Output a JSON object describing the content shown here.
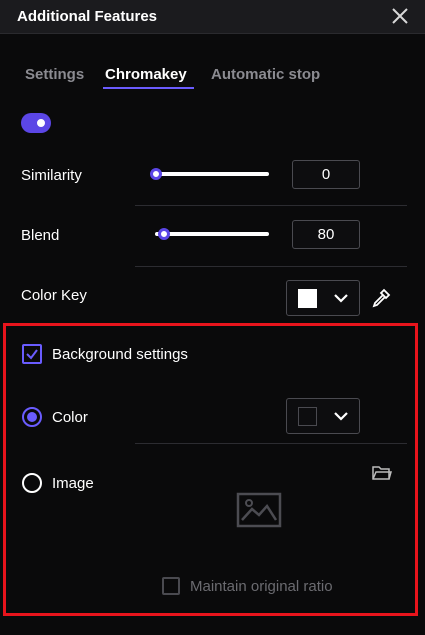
{
  "window": {
    "title": "Additional Features"
  },
  "tabs": [
    {
      "label": "Settings",
      "active": false
    },
    {
      "label": "Chromakey",
      "active": true
    },
    {
      "label": "Automatic stop",
      "active": false
    }
  ],
  "chromakey": {
    "enabled": true,
    "similarity": {
      "label": "Similarity",
      "value": "0",
      "slider_fraction": 0.0
    },
    "blend": {
      "label": "Blend",
      "value": "80",
      "slider_fraction": 0.08
    },
    "color_key": {
      "label": "Color Key",
      "color": "#ffffff"
    }
  },
  "background": {
    "checkbox_label": "Background settings",
    "checked": true,
    "color_option": {
      "label": "Color",
      "selected": true,
      "color": "#0d0d0f"
    },
    "image_option": {
      "label": "Image",
      "selected": false
    },
    "maintain_ratio_label": "Maintain original ratio",
    "maintain_ratio_checked": false
  },
  "colors": {
    "accent": "#5b46e6",
    "highlight_border": "#e8141c"
  }
}
